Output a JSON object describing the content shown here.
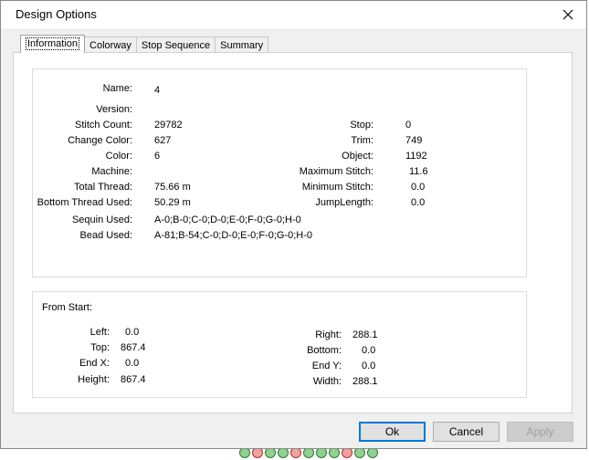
{
  "window": {
    "title": "Design Options"
  },
  "tabs": [
    {
      "label": "Information",
      "active": true
    },
    {
      "label": "Colorway",
      "active": false
    },
    {
      "label": "Stop Sequence",
      "active": false
    },
    {
      "label": "Summary",
      "active": false
    }
  ],
  "info": {
    "name": {
      "label": "Name:",
      "value": "4"
    },
    "version": {
      "label": "Version:",
      "value": ""
    },
    "stitch_count": {
      "label": "Stitch Count:",
      "value": "29782"
    },
    "change_color": {
      "label": "Change Color:",
      "value": "627"
    },
    "color": {
      "label": "Color:",
      "value": "6"
    },
    "machine": {
      "label": "Machine:",
      "value": ""
    },
    "total_thread": {
      "label": "Total Thread:",
      "value": "75.66 m"
    },
    "bottom_thread": {
      "label": "Bottom Thread Used:",
      "value": "50.29 m"
    },
    "sequin_used": {
      "label": "Sequin Used:",
      "value": "A-0;B-0;C-0;D-0;E-0;F-0;G-0;H-0"
    },
    "bead_used": {
      "label": "Bead Used:",
      "value": "A-81;B-54;C-0;D-0;E-0;F-0;G-0;H-0"
    },
    "stop": {
      "label": "Stop:",
      "value": "0"
    },
    "trim": {
      "label": "Trim:",
      "value": "749"
    },
    "object": {
      "label": "Object:",
      "value": "1192"
    },
    "max_stitch": {
      "label": "Maximum Stitch:",
      "value": "11.6"
    },
    "min_stitch": {
      "label": "Minimum Stitch:",
      "value": "0.0"
    },
    "jump_length": {
      "label": "JumpLength:",
      "value": "0.0"
    }
  },
  "from_start": {
    "heading": "From Start:",
    "left": {
      "label": "Left:",
      "value": "0.0"
    },
    "top": {
      "label": "Top:",
      "value": "867.4"
    },
    "end_x": {
      "label": "End X:",
      "value": "0.0"
    },
    "height": {
      "label": "Height:",
      "value": "867.4"
    },
    "right": {
      "label": "Right:",
      "value": "288.1"
    },
    "bottom": {
      "label": "Bottom:",
      "value": "0.0"
    },
    "end_y": {
      "label": "End Y:",
      "value": "0.0"
    },
    "width": {
      "label": "Width:",
      "value": "288.1"
    }
  },
  "buttons": {
    "ok": "Ok",
    "cancel": "Cancel",
    "apply": "Apply"
  },
  "colors": {
    "accent": "#0078d7",
    "panel": "#f0f0f0",
    "disabled_text": "#a0a0a0"
  }
}
